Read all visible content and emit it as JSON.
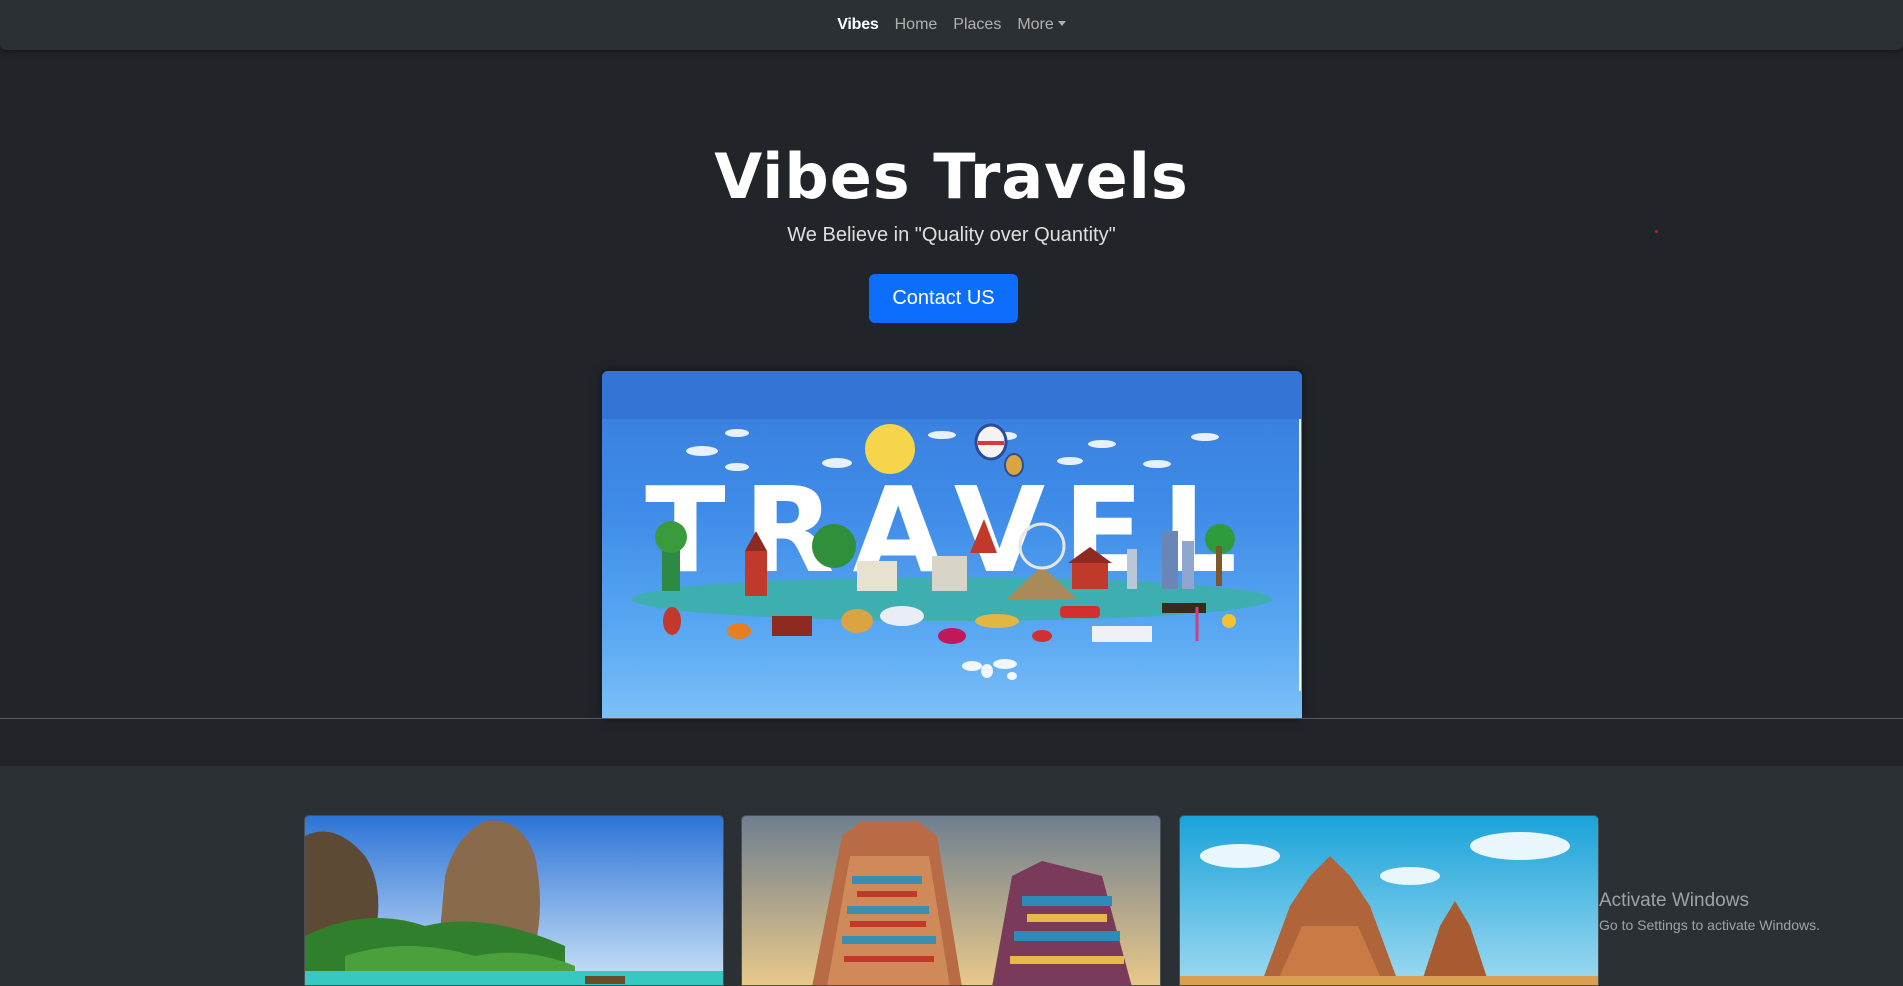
{
  "navbar": {
    "brand": "Vibes",
    "links": [
      "Home",
      "Places"
    ],
    "dropdown_label": "More"
  },
  "hero": {
    "title": "Vibes Travels",
    "subtitle": "We Believe in \"Quality over Quantity\"",
    "cta_label": "Contact US",
    "image_text": "TRAVEL"
  },
  "cards": [
    {
      "scene": "beach-cliffs"
    },
    {
      "scene": "temple-gopuram"
    },
    {
      "scene": "shore-temple"
    }
  ],
  "watermark": {
    "title": "Activate Windows",
    "subtitle": "Go to Settings to activate Windows."
  },
  "colors": {
    "background": "#212529",
    "navbar": "#2b3035",
    "primary": "#0d6efd"
  }
}
